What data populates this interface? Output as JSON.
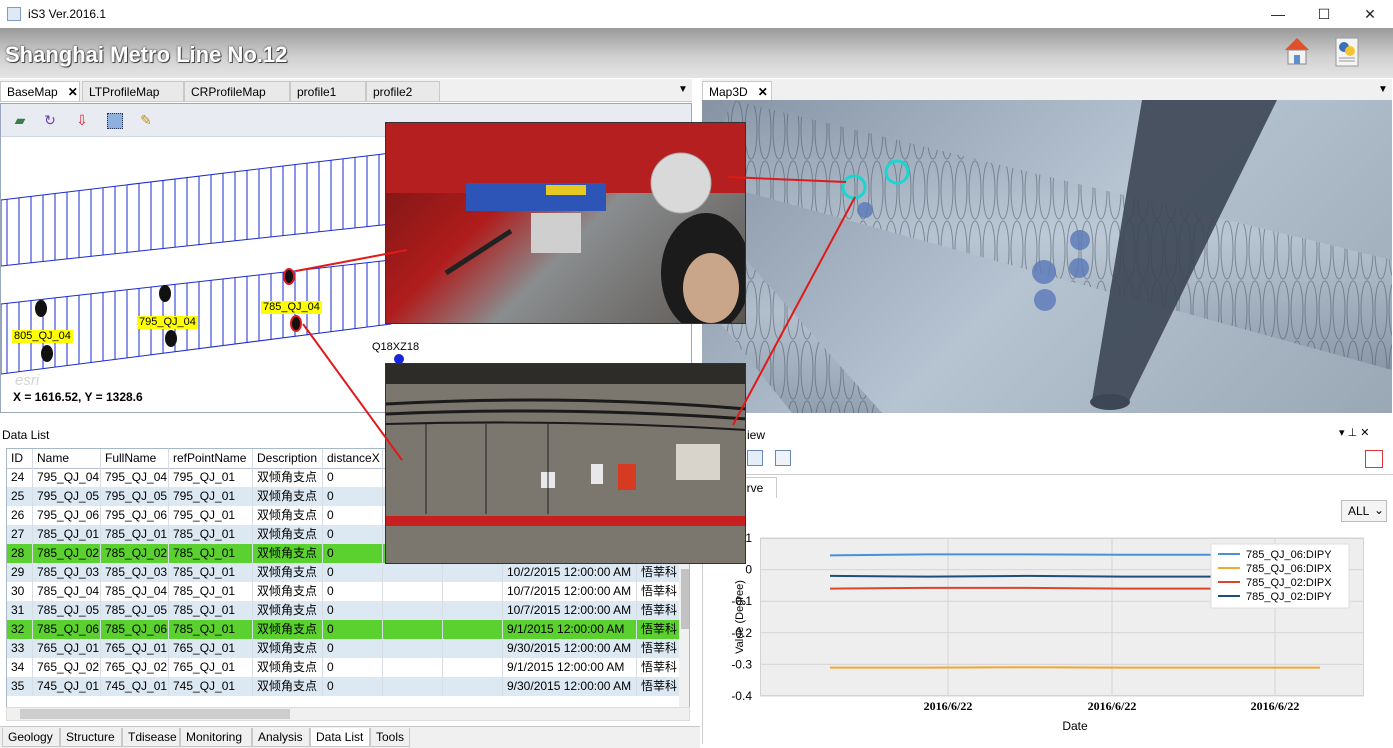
{
  "window": {
    "title": "iS3 Ver.2016.1",
    "min": "—",
    "max": "☐",
    "close": "✕"
  },
  "header": {
    "title": "Shanghai Metro Line No.12",
    "icons": [
      "home-icon",
      "python-script-icon"
    ]
  },
  "left_tabs": [
    {
      "label": "BaseMap",
      "close": "✕",
      "active": true
    },
    {
      "label": "LTProfileMap"
    },
    {
      "label": "CRProfileMap"
    },
    {
      "label": "profile1"
    },
    {
      "label": "profile2"
    }
  ],
  "right_tabs": [
    {
      "label": "Map3D",
      "close": "✕",
      "active": true
    }
  ],
  "menu_chevron": "▼",
  "map": {
    "tools": [
      "layers-icon",
      "refresh-icon",
      "pin-icon",
      "select-rect-icon",
      "edit-pencil-icon"
    ],
    "labels": [
      "805_QJ_04",
      "795_QJ_04",
      "785_QJ_04"
    ],
    "station_label": "Q18XZ18",
    "watermark": "esri",
    "coord_readout": "X = 1616.52, Y = 1328.6"
  },
  "datalist": {
    "title": "Data List",
    "columns": [
      "ID",
      "Name",
      "FullName",
      "refPointName",
      "Description",
      "distanceX"
    ],
    "rows": [
      {
        "id": "24",
        "name": "795_QJ_04",
        "full": "795_QJ_04",
        "ref": "795_QJ_01",
        "desc": "双倾角支点",
        "dx": "0",
        "date": "",
        "org": "",
        "style": "white"
      },
      {
        "id": "25",
        "name": "795_QJ_05",
        "full": "795_QJ_05",
        "ref": "795_QJ_01",
        "desc": "双倾角支点",
        "dx": "0",
        "date": "",
        "org": "",
        "style": "alt"
      },
      {
        "id": "26",
        "name": "795_QJ_06",
        "full": "795_QJ_06",
        "ref": "795_QJ_01",
        "desc": "双倾角支点",
        "dx": "0",
        "date": "",
        "org": "",
        "style": "white"
      },
      {
        "id": "27",
        "name": "785_QJ_01",
        "full": "785_QJ_01",
        "ref": "785_QJ_01",
        "desc": "双倾角支点",
        "dx": "0",
        "date": "",
        "org": "",
        "style": "alt"
      },
      {
        "id": "28",
        "name": "785_QJ_02",
        "full": "785_QJ_02",
        "ref": "785_QJ_01",
        "desc": "双倾角支点",
        "dx": "0",
        "date": "",
        "org": "",
        "style": "sel"
      },
      {
        "id": "29",
        "name": "785_QJ_03",
        "full": "785_QJ_03",
        "ref": "785_QJ_01",
        "desc": "双倾角支点",
        "dx": "0",
        "date": "10/2/2015 12:00:00 AM",
        "org": "悟莘科",
        "style": "alt"
      },
      {
        "id": "30",
        "name": "785_QJ_04",
        "full": "785_QJ_04",
        "ref": "785_QJ_01",
        "desc": "双倾角支点",
        "dx": "0",
        "date": "10/7/2015 12:00:00 AM",
        "org": "悟莘科",
        "style": "white"
      },
      {
        "id": "31",
        "name": "785_QJ_05",
        "full": "785_QJ_05",
        "ref": "785_QJ_01",
        "desc": "双倾角支点",
        "dx": "0",
        "date": "10/7/2015 12:00:00 AM",
        "org": "悟莘科",
        "style": "alt"
      },
      {
        "id": "32",
        "name": "785_QJ_06",
        "full": "785_QJ_06",
        "ref": "785_QJ_01",
        "desc": "双倾角支点",
        "dx": "0",
        "date": "9/1/2015 12:00:00 AM",
        "org": "悟莘科",
        "style": "sel"
      },
      {
        "id": "33",
        "name": "765_QJ_01",
        "full": "765_QJ_01",
        "ref": "765_QJ_01",
        "desc": "双倾角支点",
        "dx": "0",
        "date": "9/30/2015 12:00:00 AM",
        "org": "悟莘科",
        "style": "alt"
      },
      {
        "id": "34",
        "name": "765_QJ_02",
        "full": "765_QJ_02",
        "ref": "765_QJ_01",
        "desc": "双倾角支点",
        "dx": "0",
        "date": "9/1/2015 12:00:00 AM",
        "org": "悟莘科",
        "style": "white"
      },
      {
        "id": "35",
        "name": "745_QJ_01",
        "full": "745_QJ_01",
        "ref": "745_QJ_01",
        "desc": "双倾角支点",
        "dx": "0",
        "date": "9/30/2015 12:00:00 AM",
        "org": "悟莘科",
        "style": "alt"
      }
    ]
  },
  "bottom_tabs": [
    "Geology",
    "Structure",
    "Tdisease",
    "Monitoring",
    "Analysis",
    "Data List",
    "Tools"
  ],
  "bottom_tab_active": "Data List",
  "view_panel": {
    "title_fragment": "iew",
    "pin": "▾ ⊥ ✕",
    "subtab": "urve",
    "filter_value": "ALL",
    "filter_arrow": "⌄"
  },
  "chart_data": {
    "type": "line",
    "ylabel": "Value (Degree)",
    "xlabel": "Date",
    "ylim": [
      -0.4,
      0.1
    ],
    "yticks": [
      "0.1",
      "0",
      "-0.1",
      "-0.2",
      "-0.3",
      "-0.4"
    ],
    "xticks": [
      "2016/6/22",
      "2016/6/22",
      "2016/6/22"
    ],
    "legend_position": "top-right",
    "grid": true,
    "series": [
      {
        "name": "785_QJ_06:DIPY",
        "color": "#4a90d9",
        "values": [
          0.045,
          0.048,
          0.048,
          0.047,
          0.047,
          0.047
        ]
      },
      {
        "name": "785_QJ_06:DIPX",
        "color": "#f0a830",
        "values": [
          -0.31,
          -0.31,
          -0.309,
          -0.31,
          -0.31,
          -0.31
        ]
      },
      {
        "name": "785_QJ_02:DIPX",
        "color": "#d9472b",
        "values": [
          -0.06,
          -0.058,
          -0.058,
          -0.06,
          -0.06,
          -0.06
        ]
      },
      {
        "name": "785_QJ_02:DIPY",
        "color": "#1f4e79",
        "values": [
          -0.02,
          -0.022,
          -0.02,
          -0.022,
          -0.022,
          -0.022
        ]
      }
    ]
  }
}
